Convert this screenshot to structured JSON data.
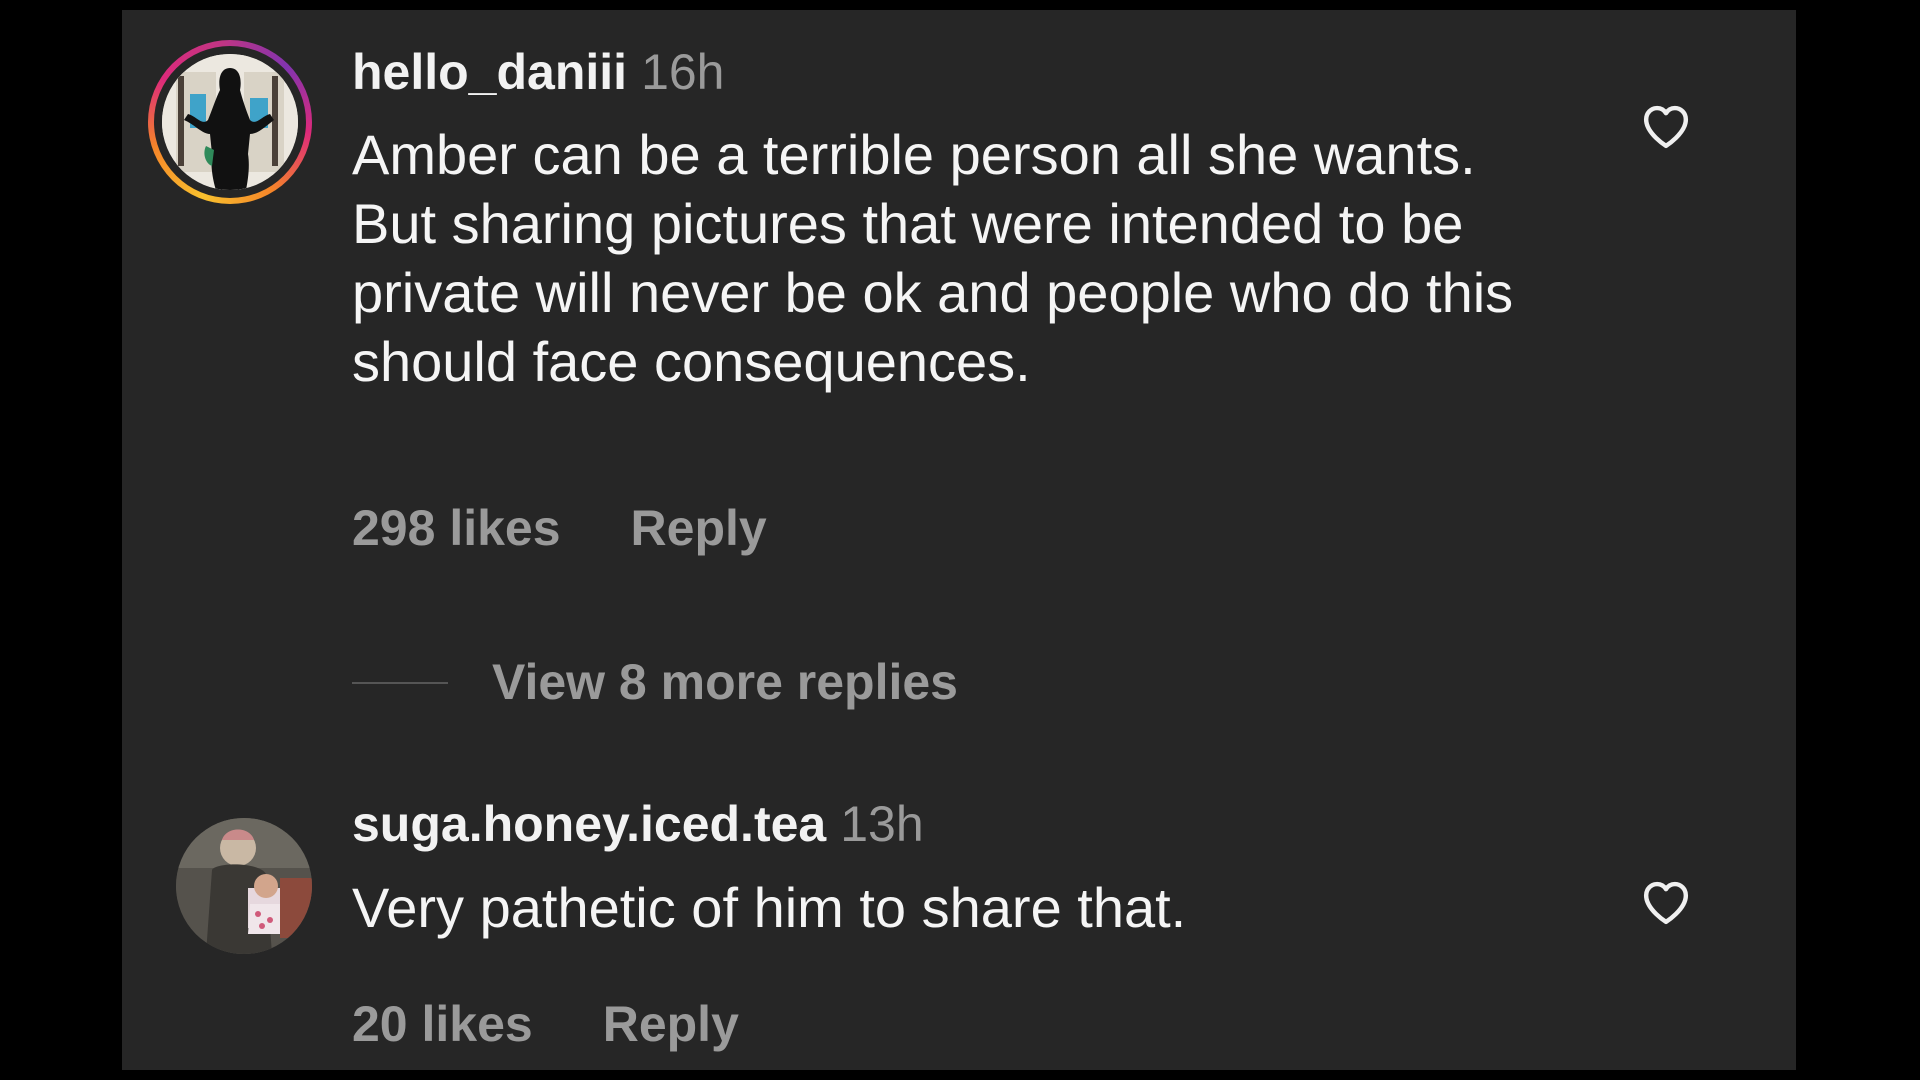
{
  "comments": [
    {
      "username": "hello_daniii",
      "time": "16h",
      "text": "Amber can be a terrible person all she wants. But sharing pictures that were intended to be private will never be ok and people who do this should face consequences.",
      "likes": "298 likes",
      "reply_label": "Reply",
      "has_story_ring": true,
      "view_more_replies": "View 8 more replies"
    },
    {
      "username": "suga.honey.iced.tea",
      "time": "13h",
      "text": "Very pathetic of him to share that.",
      "likes": "20 likes",
      "reply_label": "Reply",
      "has_story_ring": false
    }
  ],
  "icons": {
    "like": "heart-outline-icon"
  },
  "colors": {
    "background": "#262626",
    "text_primary": "#f5f5f5",
    "text_secondary": "#9a9a9a",
    "outer": "#000000"
  }
}
